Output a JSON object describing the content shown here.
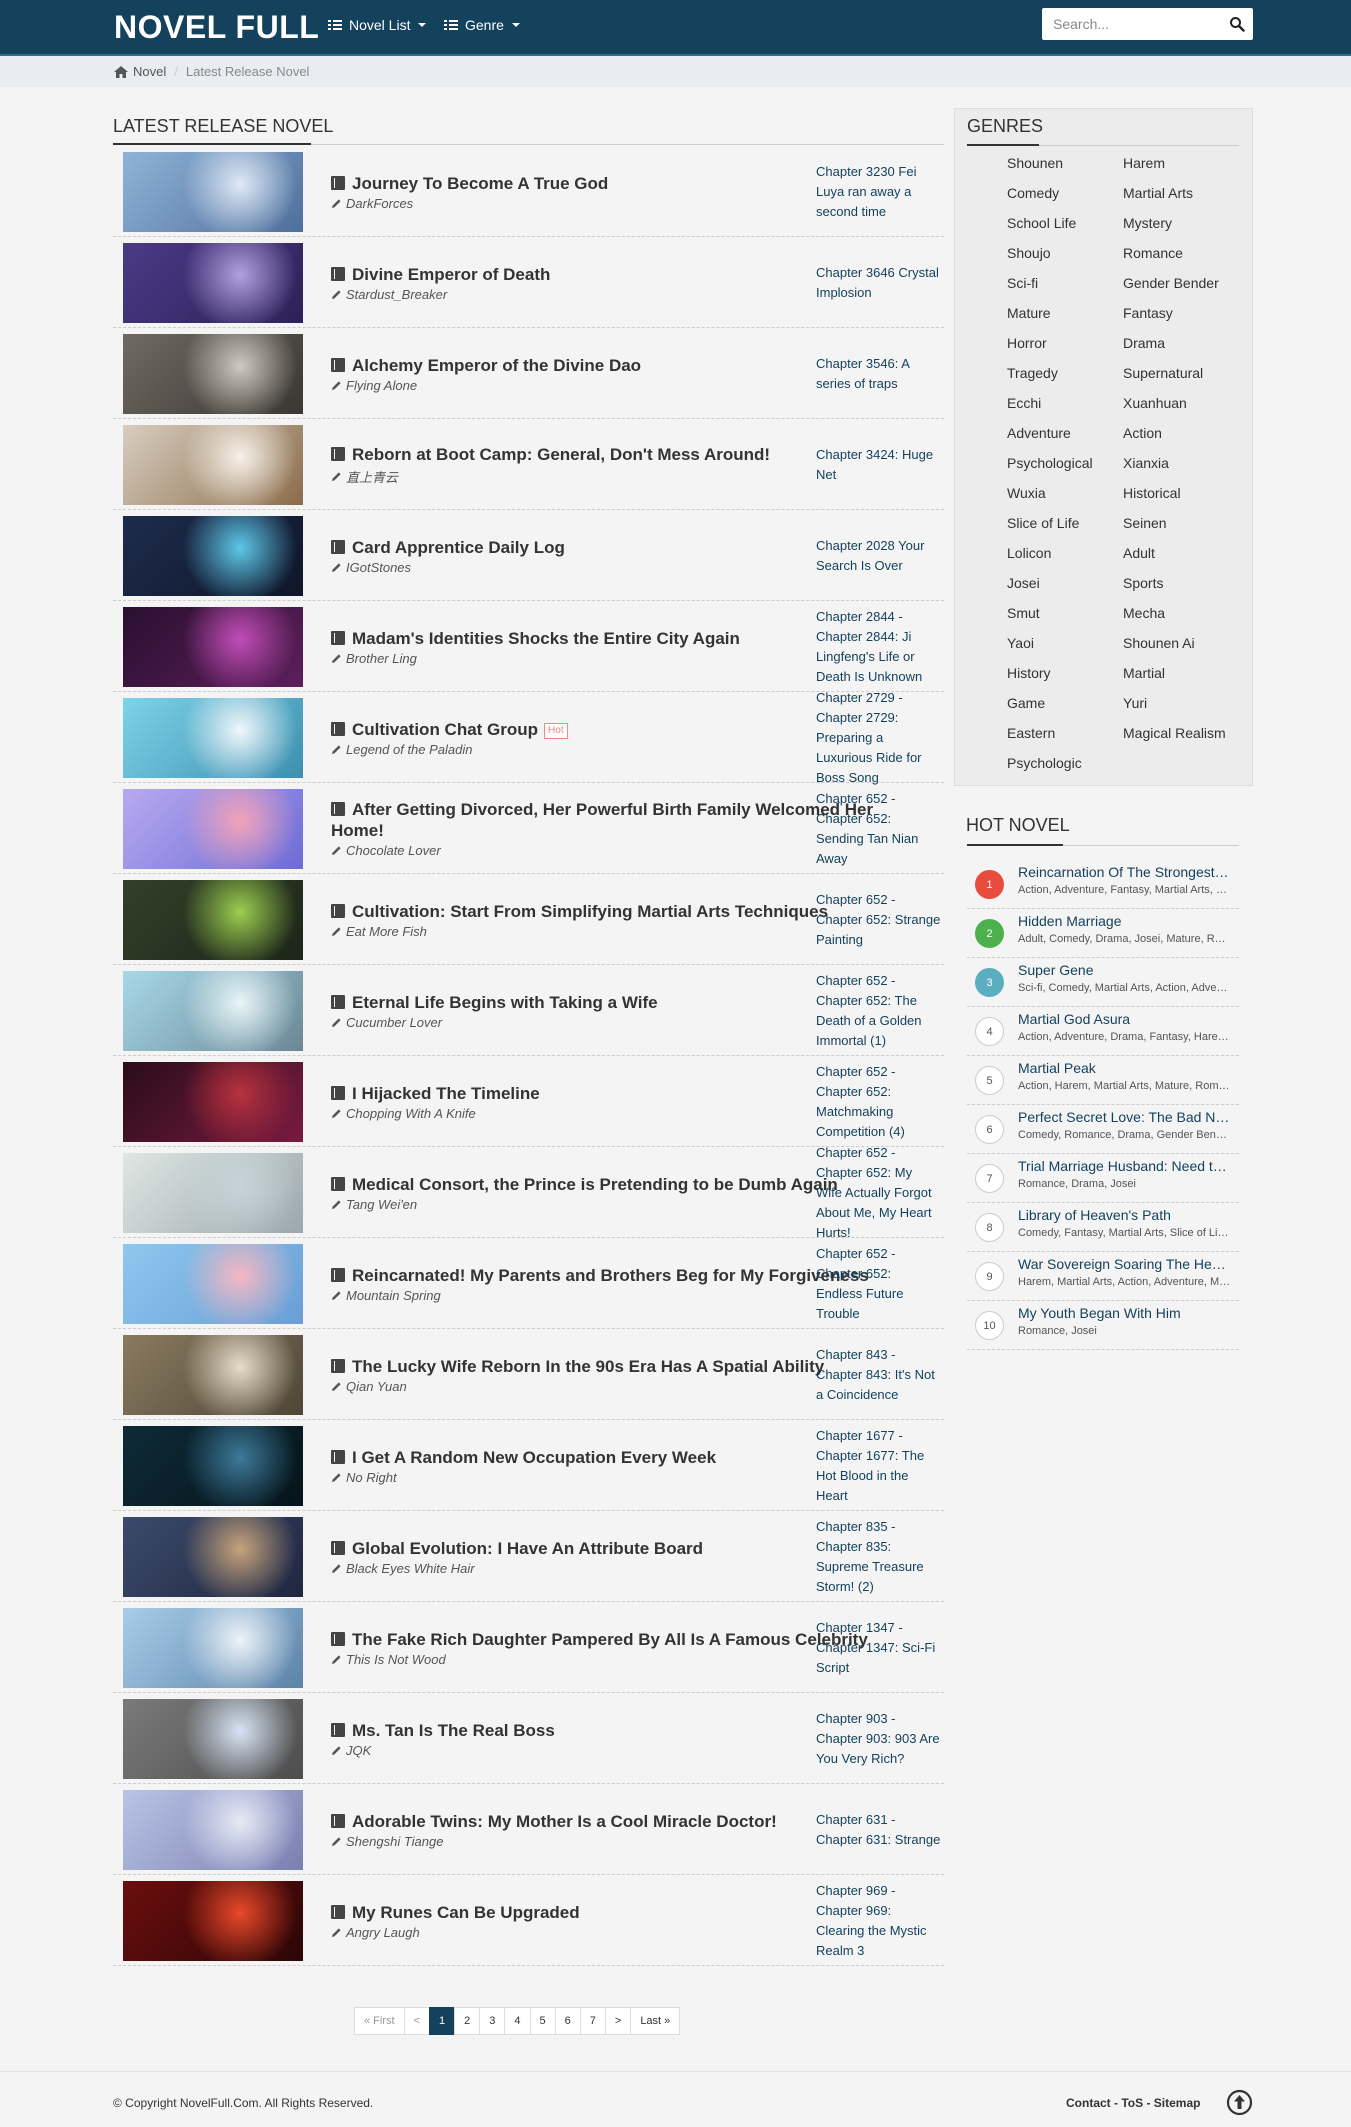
{
  "header": {
    "logo": "NOVEL FULL",
    "nav_novel_list": "Novel List",
    "nav_genre": "Genre",
    "search_placeholder": "Search..."
  },
  "breadcrumb": {
    "home": "Novel",
    "current": "Latest Release Novel"
  },
  "main": {
    "section_title": "LATEST RELEASE NOVEL",
    "hot_badge": "Hot",
    "novels": [
      {
        "title": "Journey To Become A True God",
        "author": "DarkForces",
        "chapter": "Chapter 3230 Fei Luya ran away a second time",
        "hot": false
      },
      {
        "title": "Divine Emperor of Death",
        "author": "Stardust_Breaker",
        "chapter": "Chapter 3646 Crystal Implosion",
        "hot": false
      },
      {
        "title": "Alchemy Emperor of the Divine Dao",
        "author": "Flying Alone",
        "chapter": "Chapter 3546: A series of traps",
        "hot": false
      },
      {
        "title": "Reborn at Boot Camp: General, Don't Mess Around!",
        "author": "直上青云",
        "chapter": "Chapter 3424: Huge Net",
        "hot": false
      },
      {
        "title": "Card Apprentice Daily Log",
        "author": "IGotStones",
        "chapter": "Chapter 2028 Your Search Is Over",
        "hot": false
      },
      {
        "title": "Madam's Identities Shocks the Entire City Again",
        "author": "Brother Ling",
        "chapter": "Chapter 2844 - Chapter 2844: Ji Lingfeng's Life or Death Is Unknown",
        "hot": false
      },
      {
        "title": "Cultivation Chat Group",
        "author": "Legend of the Paladin",
        "chapter": "Chapter 2729 - Chapter 2729: Preparing a Luxurious Ride for Boss Song",
        "hot": true
      },
      {
        "title": "After Getting Divorced, Her Powerful Birth Family Welcomed Her Home!",
        "author": "Chocolate Lover",
        "chapter": "Chapter 652 - Chapter 652: Sending Tan Nian Away",
        "hot": false
      },
      {
        "title": "Cultivation: Start From Simplifying Martial Arts Techniques",
        "author": "Eat More Fish",
        "chapter": "Chapter 652 - Chapter 652: Strange Painting",
        "hot": false
      },
      {
        "title": "Eternal Life Begins with Taking a Wife",
        "author": "Cucumber Lover",
        "chapter": "Chapter 652 - Chapter 652: The Death of a Golden Immortal (1)",
        "hot": false
      },
      {
        "title": "I Hijacked The Timeline",
        "author": "Chopping With A Knife",
        "chapter": "Chapter 652 - Chapter 652: Matchmaking Competition (4)",
        "hot": false
      },
      {
        "title": "Medical Consort, the Prince is Pretending to be Dumb Again",
        "author": "Tang Wei'en",
        "chapter": "Chapter 652 - Chapter 652: My Wife Actually Forgot About Me, My Heart Hurts!",
        "hot": false
      },
      {
        "title": "Reincarnated! My Parents and Brothers Beg for My Forgiveness",
        "author": "Mountain Spring",
        "chapter": "Chapter 652 - Chapter 652: Endless Future Trouble",
        "hot": false
      },
      {
        "title": "The Lucky Wife Reborn In the 90s Era Has A Spatial Ability",
        "author": "Qian Yuan",
        "chapter": "Chapter 843 - Chapter 843: It's Not a Coincidence",
        "hot": false
      },
      {
        "title": "I Get A Random New Occupation Every Week",
        "author": "No Right",
        "chapter": "Chapter 1677 - Chapter 1677: The Hot Blood in the Heart",
        "hot": false
      },
      {
        "title": "Global Evolution: I Have An Attribute Board",
        "author": "Black Eyes White Hair",
        "chapter": "Chapter 835 - Chapter 835: Supreme Treasure Storm! (2)",
        "hot": false
      },
      {
        "title": "The Fake Rich Daughter Pampered By All Is A Famous Celebrity",
        "author": "This Is Not Wood",
        "chapter": "Chapter 1347 - Chapter 1347: Sci-Fi Script",
        "hot": false
      },
      {
        "title": "Ms. Tan Is The Real Boss",
        "author": "JQK",
        "chapter": "Chapter 903 - Chapter 903: 903 Are You Very Rich?",
        "hot": false
      },
      {
        "title": "Adorable Twins: My Mother Is a Cool Miracle Doctor!",
        "author": "Shengshi Tiange",
        "chapter": "Chapter 631 - Chapter 631: Strange",
        "hot": false
      },
      {
        "title": "My Runes Can Be Upgraded",
        "author": "Angry Laugh",
        "chapter": "Chapter 969 - Chapter 969: Clearing the Mystic Realm 3",
        "hot": false
      }
    ]
  },
  "pagination": {
    "first": "« First",
    "prev": "<",
    "pages": [
      "1",
      "2",
      "3",
      "4",
      "5",
      "6",
      "7"
    ],
    "next": ">",
    "last": "Last »",
    "current": "1"
  },
  "sidebar": {
    "genres_title": "GENRES",
    "genres_left": [
      "Shounen",
      "Comedy",
      "School Life",
      "Shoujo",
      "Sci-fi",
      "Mature",
      "Horror",
      "Tragedy",
      "Ecchi",
      "Adventure",
      "Psychological",
      "Wuxia",
      "Slice of Life",
      "Lolicon",
      "Josei",
      "Smut",
      "Yaoi",
      "History",
      "Game",
      "Eastern",
      "Psychologic"
    ],
    "genres_right": [
      "Harem",
      "Martial Arts",
      "Mystery",
      "Romance",
      "Gender Bender",
      "Fantasy",
      "Drama",
      "Supernatural",
      "Xuanhuan",
      "Action",
      "Xianxia",
      "Historical",
      "Seinen",
      "Adult",
      "Sports",
      "Mecha",
      "Shounen Ai",
      "Martial",
      "Yuri",
      "Magical Realism"
    ],
    "hot_title": "HOT NOVEL",
    "hot_novels": [
      {
        "rank": "1",
        "title": "Reincarnation Of The Strongest Sword God",
        "genres": "Action, Adventure, Fantasy, Martial Arts, Xuanhuan"
      },
      {
        "rank": "2",
        "title": "Hidden Marriage",
        "genres": "Adult, Comedy, Drama, Josei, Mature, Romance"
      },
      {
        "rank": "3",
        "title": "Super Gene",
        "genres": "Sci-fi, Comedy, Martial Arts, Action, Adventure"
      },
      {
        "rank": "4",
        "title": "Martial God Asura",
        "genres": "Action, Adventure, Drama, Fantasy, Harem, Martial Arts"
      },
      {
        "rank": "5",
        "title": "Martial Peak",
        "genres": "Action, Harem, Martial Arts, Mature, Romance"
      },
      {
        "rank": "6",
        "title": "Perfect Secret Love: The Bad New Wife is a Little Sweet",
        "genres": "Comedy, Romance, Drama, Gender Bender, Josei"
      },
      {
        "rank": "7",
        "title": "Trial Marriage Husband: Need to Work Hard",
        "genres": "Romance, Drama, Josei"
      },
      {
        "rank": "8",
        "title": "Library of Heaven's Path",
        "genres": "Comedy, Fantasy, Martial Arts, Slice of Life, Xuanhuan"
      },
      {
        "rank": "9",
        "title": "War Sovereign Soaring The Heavens",
        "genres": "Harem, Martial Arts, Action, Adventure, Mature"
      },
      {
        "rank": "10",
        "title": "My Youth Began With Him",
        "genres": "Romance, Josei"
      }
    ]
  },
  "footer": {
    "copyright": "© Copyright NovelFull.Com. All Rights Reserved.",
    "links": "Contact - ToS - Sitemap"
  },
  "colors": {
    "header_bg": "#14425d",
    "link": "#14425d",
    "rank1": "#e74c3c",
    "rank2": "#4cb04c",
    "rank3": "#5aaec0"
  }
}
